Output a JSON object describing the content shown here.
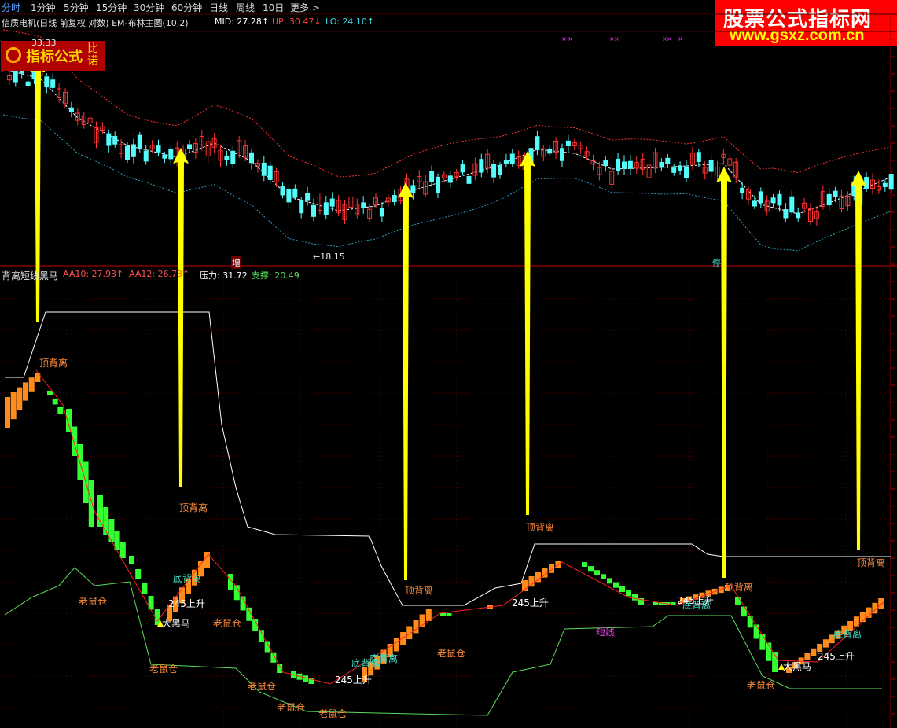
{
  "tabs": [
    "分时",
    "1分钟",
    "5分钟",
    "15分钟",
    "30分钟",
    "60分钟",
    "日线",
    "周线",
    "10日",
    "更多 >"
  ],
  "active_tab": 0,
  "main_header": {
    "title": "信质电机(日线 前复权 对数) EM-布林主图(10,2)",
    "mid": "MID: 27.28↑",
    "up": "UP: 30.47↓",
    "lo": "LO: 24.10↑"
  },
  "watermark": {
    "line1": "股票公式指标网",
    "line2": "www.gsxz.com.cn"
  },
  "logo": {
    "text": "指标公式",
    "side": "比诺"
  },
  "main_annotations": {
    "high": "33.33",
    "low": "←18.15",
    "tag_zeng": "增",
    "tag_ting": "停"
  },
  "sub_header": {
    "title": "背离短线黑马",
    "aa10": "AA10: 27.93↑",
    "aa12": "AA12: 26.73↑",
    "pressure": "压力: 31.72",
    "support": "支撑: 20.49"
  },
  "colors": {
    "bg": "#000000",
    "up_candle": "#ff3232",
    "down_candle": "#54fcfc",
    "mid_line": "#ffffff",
    "upper_band": "#ff3232",
    "lower_band": "#30a0c0",
    "arrow": "#ffff00",
    "bar_up": "#ff8c1a",
    "bar_down": "#33ff33",
    "pressure_line": "#ffffff",
    "support_line": "#5adc5a",
    "signal_text": "#ff8c3c",
    "bottom_text": "#40e0c8",
    "grid": "#5a0000",
    "panel_line": "#a00000"
  },
  "chart_data": {
    "type": "candlestick+oscillator",
    "main_price_labels": {
      "high": 33.33,
      "low": 18.15
    },
    "bollinger": {
      "mid": 27.28,
      "up": 30.47,
      "lo": 24.1
    },
    "indicator": {
      "AA10": 27.93,
      "AA12": 26.73,
      "pressure": 31.72,
      "support": 20.49
    },
    "signals": [
      {
        "text": "顶背离",
        "kind": "top"
      },
      {
        "text": "顶背离",
        "kind": "top"
      },
      {
        "text": "顶背离",
        "kind": "top"
      },
      {
        "text": "顶背离",
        "kind": "top"
      },
      {
        "text": "顶背离",
        "kind": "top"
      },
      {
        "text": "顶背离",
        "kind": "top"
      },
      {
        "text": "底背离",
        "kind": "bottom"
      },
      {
        "text": "底背离",
        "kind": "bottom"
      },
      {
        "text": "底背离",
        "kind": "bottom"
      },
      {
        "text": "底背离",
        "kind": "bottom"
      },
      {
        "text": "底背离",
        "kind": "bottom"
      },
      {
        "text": "245上升",
        "kind": "rise"
      },
      {
        "text": "245上升",
        "kind": "rise"
      },
      {
        "text": "245上升",
        "kind": "rise"
      },
      {
        "text": "245上升",
        "kind": "rise"
      },
      {
        "text": "245上升",
        "kind": "rise"
      },
      {
        "text": "大黑马",
        "kind": "horse"
      },
      {
        "text": "大黑马",
        "kind": "horse"
      },
      {
        "text": "老鼠仓",
        "kind": "rat"
      },
      {
        "text": "老鼠仓",
        "kind": "rat"
      },
      {
        "text": "老鼠仓",
        "kind": "rat"
      },
      {
        "text": "老鼠仓",
        "kind": "rat"
      },
      {
        "text": "老鼠仓",
        "kind": "rat"
      },
      {
        "text": "老鼠仓",
        "kind": "rat"
      },
      {
        "text": "老鼠仓",
        "kind": "rat"
      },
      {
        "text": "老鼠仓",
        "kind": "rat"
      },
      {
        "text": "短线",
        "kind": "short"
      }
    ]
  }
}
